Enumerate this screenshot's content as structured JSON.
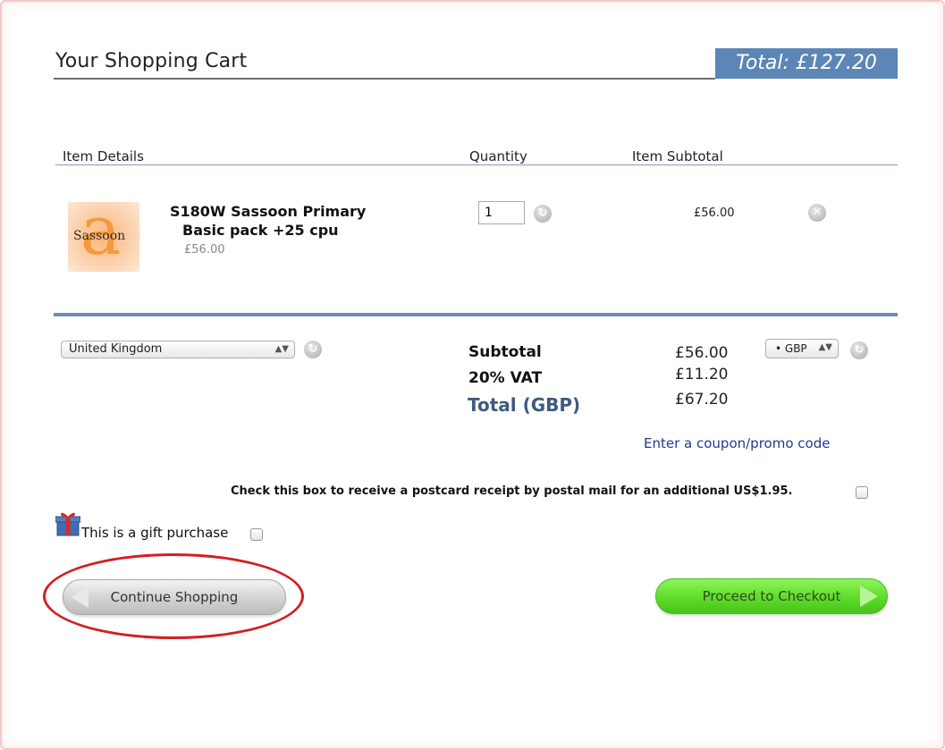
{
  "header": {
    "title": "Your Shopping Cart",
    "total_badge": "Total: £127.20"
  },
  "columns": {
    "item_details": "Item Details",
    "quantity": "Quantity",
    "item_subtotal": "Item Subtotal"
  },
  "item": {
    "thumb_brand": "Sassoon",
    "thumb_glyph": "a",
    "name_line1": "S180W Sassoon Primary",
    "name_line2": "Basic pack +25 cpu",
    "unit_price": "£56.00",
    "quantity": "1",
    "subtotal": "£56.00",
    "refresh_icon": "refresh-icon",
    "remove_icon": "remove-icon"
  },
  "location": {
    "country": "United Kingdom",
    "currency": "• GBP"
  },
  "summary": {
    "subtotal_label": "Subtotal",
    "subtotal_value": "£56.00",
    "vat_label": "20% VAT",
    "vat_value": "£11.20",
    "total_label": "Total (GBP)",
    "total_value": "£67.20"
  },
  "promo_link": "Enter a coupon/promo code",
  "postcard_text": "Check this box to receive a postcard receipt by postal mail for an additional US$1.95.",
  "gift_text": "This is a gift purchase",
  "buttons": {
    "continue": "Continue Shopping",
    "checkout": "Proceed to Checkout"
  },
  "colors": {
    "accent_blue": "#5b86b5",
    "total_text": "#3c5a82",
    "checkout_green": "#5fdb2a",
    "highlight_red": "#d41e24"
  }
}
